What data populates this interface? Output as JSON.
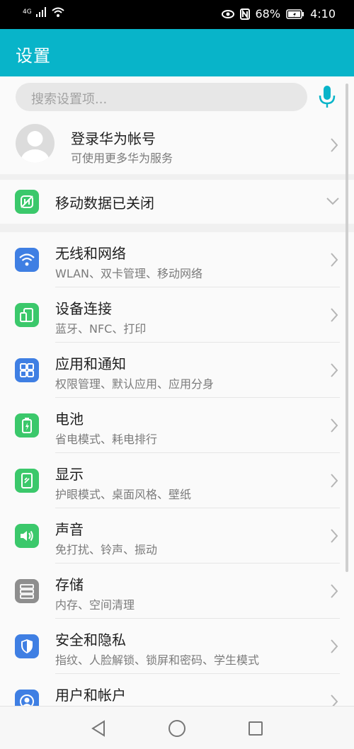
{
  "status": {
    "network": "4G",
    "battery": "68%",
    "time": "4:10"
  },
  "appbar": {
    "title": "设置"
  },
  "search": {
    "placeholder": "搜索设置项..."
  },
  "account": {
    "title": "登录华为帐号",
    "subtitle": "可使用更多华为服务"
  },
  "mobile_data": {
    "label": "移动数据已关闭"
  },
  "items": [
    {
      "title": "无线和网络",
      "subtitle": "WLAN、双卡管理、移动网络",
      "icon": "wifi-icon",
      "color": "#3f7fe3"
    },
    {
      "title": "设备连接",
      "subtitle": "蓝牙、NFC、打印",
      "icon": "device-connection-icon",
      "color": "#3bc86b"
    },
    {
      "title": "应用和通知",
      "subtitle": "权限管理、默认应用、应用分身",
      "icon": "apps-icon",
      "color": "#3f7fe3"
    },
    {
      "title": "电池",
      "subtitle": "省电模式、耗电排行",
      "icon": "battery-icon",
      "color": "#3bc86b"
    },
    {
      "title": "显示",
      "subtitle": "护眼模式、桌面风格、壁纸",
      "icon": "display-icon",
      "color": "#3bc86b"
    },
    {
      "title": "声音",
      "subtitle": "免打扰、铃声、振动",
      "icon": "sound-icon",
      "color": "#3bc86b"
    },
    {
      "title": "存储",
      "subtitle": "内存、空间清理",
      "icon": "storage-icon",
      "color": "#8e8e8e"
    },
    {
      "title": "安全和隐私",
      "subtitle": "指纹、人脸解锁、锁屏和密码、学生模式",
      "icon": "security-icon",
      "color": "#3f7fe3"
    },
    {
      "title": "用户和帐户",
      "subtitle": "",
      "icon": "user-icon",
      "color": "#3f7fe3"
    }
  ],
  "colors": {
    "accent": "#08b4c9",
    "mic": "#08b4c9"
  }
}
